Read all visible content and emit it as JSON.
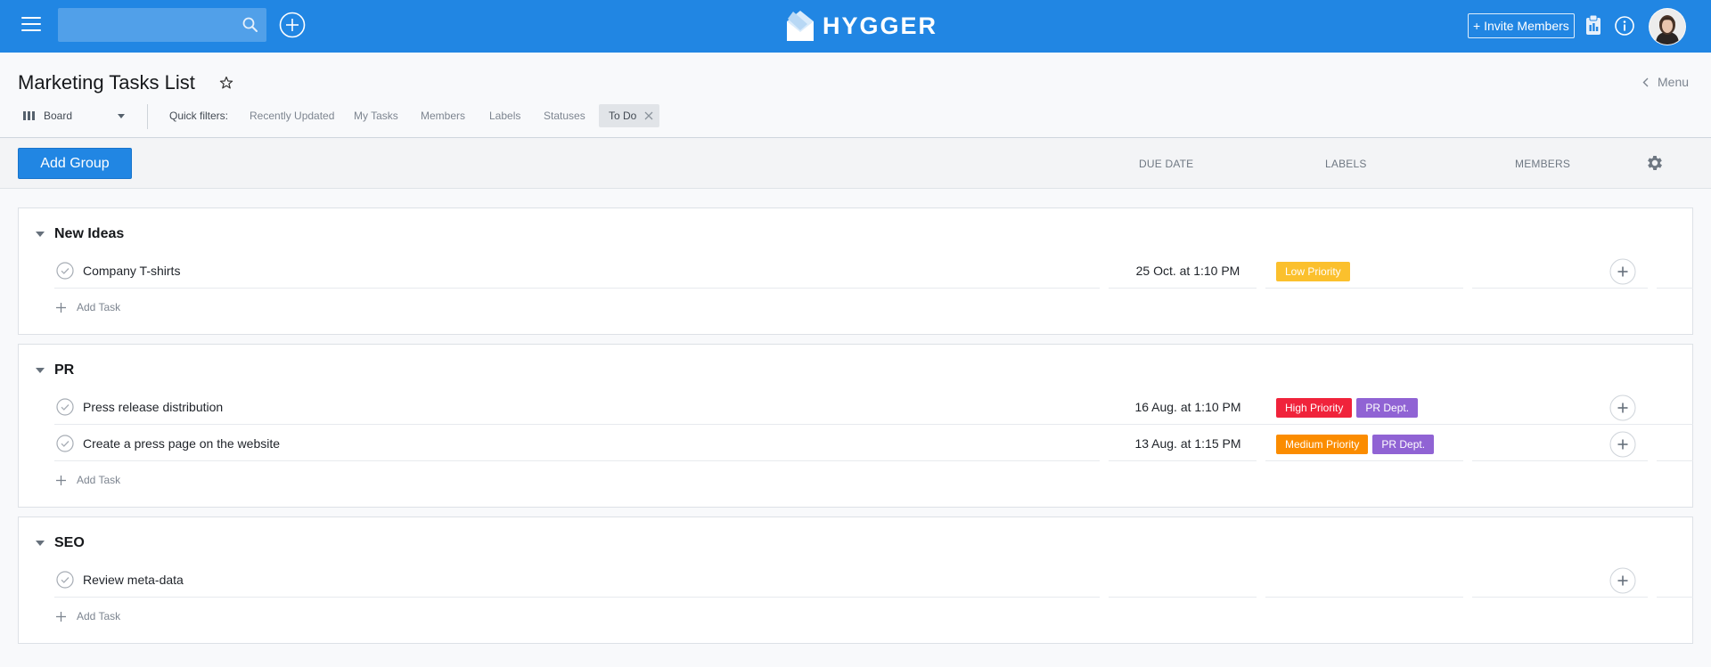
{
  "app": {
    "logo_text": "HYGGER",
    "search_placeholder": "",
    "invite_label": "+ Invite Members"
  },
  "page": {
    "title": "Marketing Tasks List",
    "menu_label": "Menu",
    "view_label": "Board"
  },
  "filters": {
    "label": "Quick filters:",
    "items": [
      "Recently Updated",
      "My Tasks",
      "Members",
      "Labels",
      "Statuses"
    ],
    "active_chip": "To Do"
  },
  "toolbar": {
    "add_group_label": "Add Group",
    "columns": [
      "DUE DATE",
      "LABELS",
      "MEMBERS"
    ]
  },
  "groups": [
    {
      "title": "New Ideas",
      "tasks": [
        {
          "name": "Company T-shirts",
          "due": "25 Oct. at 1:10 PM",
          "labels": [
            {
              "text": "Low Priority",
              "color": "#fbc02d"
            }
          ]
        }
      ],
      "add_task_label": "Add Task"
    },
    {
      "title": "PR",
      "tasks": [
        {
          "name": "Press release distribution",
          "due": "16 Aug. at 1:10 PM",
          "labels": [
            {
              "text": "High Priority",
              "color": "#f0233b"
            },
            {
              "text": "PR Dept.",
              "color": "#9063d4"
            }
          ]
        },
        {
          "name": "Create a press page on the website",
          "due": "13 Aug. at 1:15 PM",
          "labels": [
            {
              "text": "Medium Priority",
              "color": "#fb8c00"
            },
            {
              "text": "PR Dept.",
              "color": "#9063d4"
            }
          ]
        }
      ],
      "add_task_label": "Add Task"
    },
    {
      "title": "SEO",
      "tasks": [
        {
          "name": "Review meta-data",
          "due": "",
          "labels": []
        }
      ],
      "add_task_label": "Add Task"
    }
  ],
  "colors": {
    "brand": "#2186e3",
    "background": "#f8f9fb",
    "low_priority": "#fbc02d",
    "high_priority": "#f0233b",
    "medium_priority": "#fb8c00",
    "pr_dept": "#9063d4"
  }
}
